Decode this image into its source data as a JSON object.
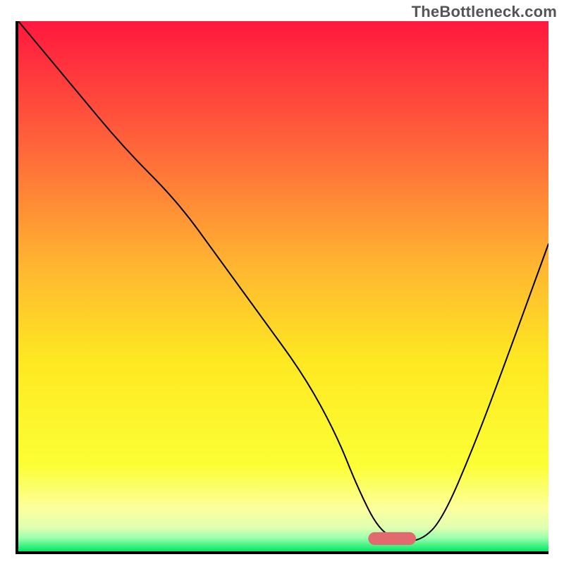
{
  "watermark": "TheBottleneck.com",
  "chart_data": {
    "type": "line",
    "title": "",
    "xlabel": "",
    "ylabel": "",
    "xlim": [
      0,
      100
    ],
    "ylim": [
      0,
      100
    ],
    "grid": false,
    "legend": false,
    "background_gradient_stops": [
      {
        "pos": 0.0,
        "color": "#ff173f"
      },
      {
        "pos": 0.25,
        "color": "#ff6a3a"
      },
      {
        "pos": 0.46,
        "color": "#ffb531"
      },
      {
        "pos": 0.64,
        "color": "#fee822"
      },
      {
        "pos": 0.84,
        "color": "#fcff35"
      },
      {
        "pos": 0.92,
        "color": "#fdff9f"
      },
      {
        "pos": 0.955,
        "color": "#e0ffb0"
      },
      {
        "pos": 0.975,
        "color": "#9affad"
      },
      {
        "pos": 1.0,
        "color": "#00e765"
      }
    ],
    "series": [
      {
        "name": "bottleneck-curve",
        "x": [
          0,
          10,
          20,
          30,
          38,
          46,
          54,
          60,
          64,
          68,
          72,
          76,
          80,
          86,
          92,
          100
        ],
        "y": [
          100,
          88,
          76,
          66,
          55,
          44,
          33,
          22,
          12,
          4,
          2,
          2,
          6,
          20,
          36,
          58
        ]
      }
    ],
    "marker": {
      "name": "optimal-zone",
      "shape": "stadium",
      "center_x": 70.5,
      "center_y": 2.4,
      "width": 9,
      "height": 2.4,
      "color": "#e26a6f"
    },
    "axis_stroke": "#010101",
    "axis_width": 4,
    "curve_stroke": "#010101",
    "curve_width": 2
  }
}
